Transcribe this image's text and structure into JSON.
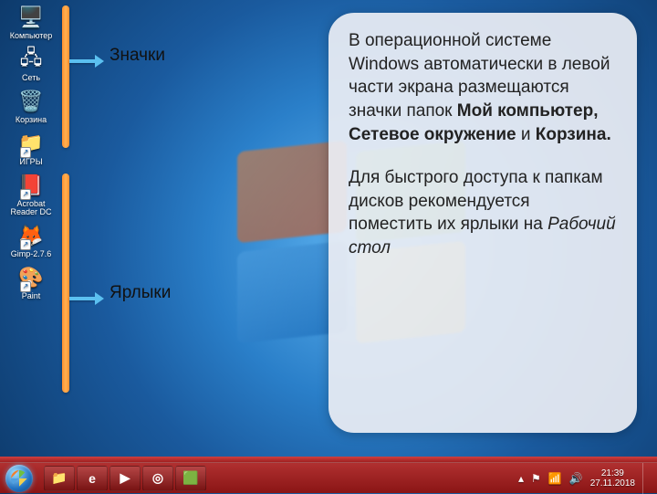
{
  "desktop_icons": [
    {
      "id": "computer",
      "label": "Компьютер",
      "glyph": "🖥️",
      "shortcut": false
    },
    {
      "id": "network",
      "label": "Сеть",
      "glyph": "🖧",
      "shortcut": false
    },
    {
      "id": "recycle",
      "label": "Корзина",
      "glyph": "🗑️",
      "shortcut": false
    },
    {
      "id": "games",
      "label": "ИГРЫ",
      "glyph": "📁",
      "shortcut": true
    },
    {
      "id": "acrobat",
      "label": "Acrobat Reader DC",
      "glyph": "📕",
      "shortcut": true
    },
    {
      "id": "gimp",
      "label": "Gimp-2.7.6",
      "glyph": "🦊",
      "shortcut": true
    },
    {
      "id": "paint",
      "label": "Paint",
      "glyph": "🎨",
      "shortcut": true
    }
  ],
  "annotations": {
    "icons_label": "Значки",
    "shortcuts_label": "Ярлыки"
  },
  "callout": {
    "p1_pre": "В операционной системе Windows автоматически в левой части экрана размещаются значки папок ",
    "p1_bold": "Мой компьютер, Сетевое окружение",
    "p1_mid": " и ",
    "p1_bold2": "Корзина.",
    "p2_pre": "Для быстрого доступа к папкам дисков рекомендуется поместить их ярлыки на ",
    "p2_italic": "Рабочий стол"
  },
  "taskbar": {
    "items": [
      {
        "id": "explorer",
        "glyph": "📁"
      },
      {
        "id": "ie",
        "glyph": "e"
      },
      {
        "id": "media",
        "glyph": "▶"
      },
      {
        "id": "app1",
        "glyph": "◎"
      },
      {
        "id": "app2",
        "glyph": "🟩"
      }
    ],
    "tray": {
      "chevron": "▴",
      "flag": "⚑",
      "net": "📶",
      "vol": "🔊",
      "time": "21:39",
      "date": "27.11.2018"
    }
  }
}
